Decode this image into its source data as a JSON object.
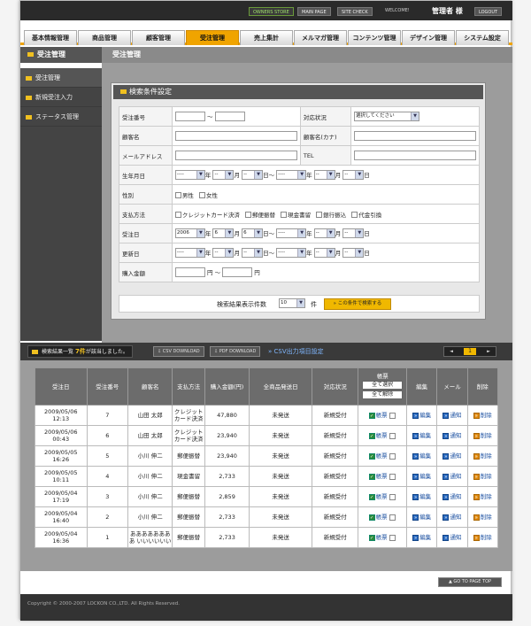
{
  "header": {
    "owners_store": "OWNERS STORE",
    "main_page": "MAIN PAGE",
    "site_check": "SITE CHECK",
    "welcome": "WELCOME!",
    "user_name": "管理者 様",
    "logout": "LOGOUT"
  },
  "nav": {
    "tabs": [
      "基本情報管理",
      "商品管理",
      "顧客管理",
      "受注管理",
      "売上集計",
      "メルマガ管理",
      "コンテンツ管理",
      "デザイン管理",
      "システム設定"
    ],
    "active": "受注管理"
  },
  "section": {
    "left_title": "受注管理",
    "title": "受注管理"
  },
  "sidebar": {
    "items": [
      {
        "label": "受注管理",
        "active": true
      },
      {
        "label": "新規受注入力",
        "active": false
      },
      {
        "label": "ステータス管理",
        "active": false
      }
    ]
  },
  "search": {
    "heading": "検索条件設定",
    "order_no_label": "受注番号",
    "tilde": "～",
    "status_label": "対応状況",
    "status_select": "選択してください",
    "customer_name_label": "顧客名",
    "customer_kana_label": "顧客名(カナ)",
    "email_label": "メールアドレス",
    "tel_label": "TEL",
    "birthday_label": "生年月日",
    "blank": "----",
    "blank_short": "--",
    "year": "年",
    "month": "月",
    "day": "日",
    "gender_label": "性別",
    "male": "男性",
    "female": "女性",
    "payment_label": "支払方法",
    "payments": [
      "クレジットカード決済",
      "郵便振替",
      "現金書留",
      "銀行振込",
      "代金引換"
    ],
    "order_date_label": "受注日",
    "order_year": "2006",
    "order_month": "6",
    "order_day": "6",
    "update_date_label": "更新日",
    "amount_label": "購入金額",
    "yen": "円",
    "count_label": "検索結果表示件数",
    "count_value": "10",
    "count_unit": "件",
    "search_button": "この条件で検索する"
  },
  "results": {
    "summary_prefix": "検索結果一覧",
    "count": "7件",
    "summary_suffix": "が該当しました。",
    "csv_download": "CSV DOWNLOAD",
    "pdf_download": "PDF DOWNLOAD",
    "csv_settings": "CSV出力項目設定",
    "page_prev": "◄",
    "page_current": "1",
    "page_next": "►",
    "columns": {
      "order_date": "受注日",
      "order_no": "受注番号",
      "customer": "顧客名",
      "payment": "支払方法",
      "amount": "購入金額(円)",
      "ship_date": "全商品発送日",
      "status": "対応状況",
      "ledger": "帳票",
      "select_all": "全て選択",
      "deselect_all": "全て解除",
      "edit": "編集",
      "mail": "メール",
      "delete": "削除"
    },
    "ledger_label": "帳票",
    "edit_label": "編集",
    "mail_label": "通知",
    "delete_label": "削除",
    "rows": [
      {
        "date": "2009/05/06",
        "time": "12:13",
        "no": "7",
        "customer": "山田 太郎",
        "payment": "クレジットカード決済",
        "amount": "47,880",
        "ship": "未発送",
        "status": "新規受付"
      },
      {
        "date": "2009/05/06",
        "time": "00:43",
        "no": "6",
        "customer": "山田 太郎",
        "payment": "クレジットカード決済",
        "amount": "23,940",
        "ship": "未発送",
        "status": "新規受付"
      },
      {
        "date": "2009/05/05",
        "time": "16:26",
        "no": "5",
        "customer": "小川 伸二",
        "payment": "郵便振替",
        "amount": "23,940",
        "ship": "未発送",
        "status": "新規受付"
      },
      {
        "date": "2009/05/05",
        "time": "10:11",
        "no": "4",
        "customer": "小川 伸二",
        "payment": "現金書留",
        "amount": "2,733",
        "ship": "未発送",
        "status": "新規受付"
      },
      {
        "date": "2009/05/04",
        "time": "17:19",
        "no": "3",
        "customer": "小川 伸二",
        "payment": "郵便振替",
        "amount": "2,859",
        "ship": "未発送",
        "status": "新規受付"
      },
      {
        "date": "2009/05/04",
        "time": "16:40",
        "no": "2",
        "customer": "小川 伸二",
        "payment": "郵便振替",
        "amount": "2,733",
        "ship": "未発送",
        "status": "新規受付"
      },
      {
        "date": "2009/05/04",
        "time": "16:36",
        "no": "1",
        "customer": "ああああああああ いいいいいい",
        "payment": "郵便振替",
        "amount": "2,733",
        "ship": "未発送",
        "status": "新規受付"
      }
    ]
  },
  "footer": {
    "to_top": "GO TO PAGE TOP",
    "copyright": "Copyright © 2000-2007 LOCKON CO.,LTD. All Rights Reserved."
  }
}
